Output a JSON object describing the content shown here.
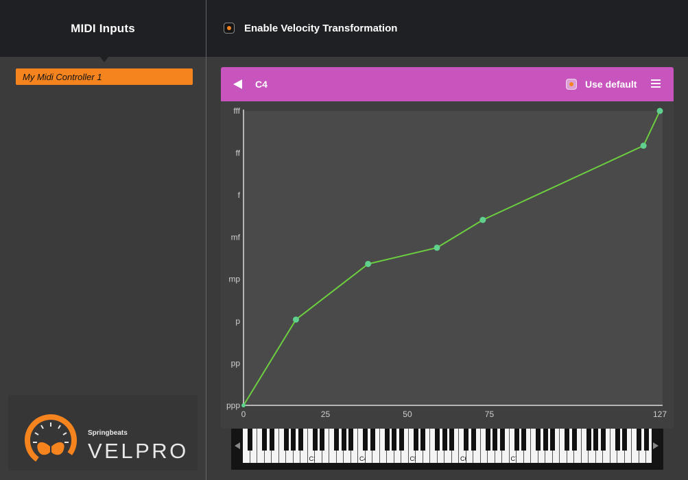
{
  "sidebar": {
    "title": "MIDI Inputs",
    "devices": [
      {
        "label": "My Midi Controller 1",
        "selected": true
      }
    ],
    "brand": {
      "company": "Springbeats",
      "product": "VELPRO",
      "logo_icon": "butterfly-gauge-icon"
    }
  },
  "header": {
    "enable_label": "Enable Velocity Transformation",
    "enabled": true
  },
  "card": {
    "note": "C4",
    "use_default_label": "Use default",
    "use_default": true,
    "back_icon": "back-arrow-icon",
    "menu_icon": "hamburger-menu-icon",
    "header_color": "#c855be"
  },
  "colors": {
    "accent": "#f5841f",
    "curve": "#6ccf3f",
    "point": "#5fd08e"
  },
  "chart_data": {
    "type": "line",
    "x_ticks": [
      "0",
      "25",
      "50",
      "75",
      "127"
    ],
    "y_ticks": [
      "ppp",
      "pp",
      "p",
      "mp",
      "mf",
      "f",
      "ff",
      "fff"
    ],
    "xlim": [
      0,
      127
    ],
    "ylim": [
      0,
      127
    ],
    "points": [
      {
        "x": 0,
        "y": 0
      },
      {
        "x": 16,
        "y": 37
      },
      {
        "x": 38,
        "y": 61
      },
      {
        "x": 59,
        "y": 68
      },
      {
        "x": 73,
        "y": 80
      },
      {
        "x": 122,
        "y": 112
      },
      {
        "x": 127,
        "y": 127
      }
    ]
  },
  "keyboard": {
    "octave_labels": [
      "C3",
      "C4",
      "C5",
      "C6",
      "C7"
    ]
  }
}
